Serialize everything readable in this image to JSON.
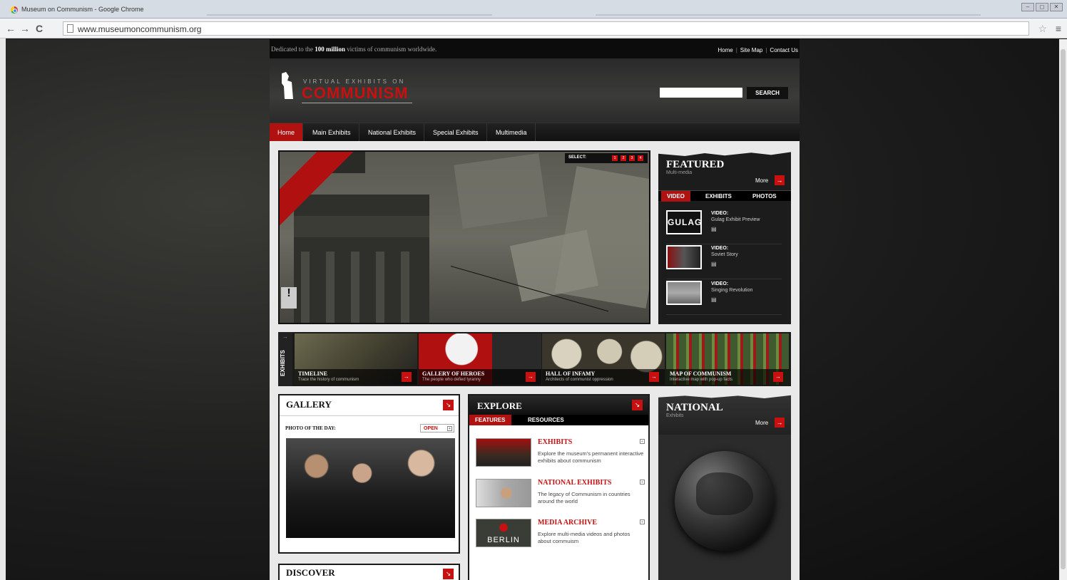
{
  "browser": {
    "window_title": "Museum on Communism - Google Chrome",
    "url": "www.museumoncommunism.org",
    "window_buttons": [
      "‒",
      "◻",
      "✕"
    ]
  },
  "site": {
    "dedication_pre": "Dedicated to the ",
    "dedication_bold": "100 million",
    "dedication_post": " victims of communism worldwide.",
    "top_links": [
      "Home",
      "Site Map",
      "Contact Us"
    ],
    "logo_sub": "VIRTUAL EXHIBITS ON",
    "logo_main": "COMMUNISM",
    "search_button": "SEARCH",
    "nav": [
      "Home",
      "Main Exhibits",
      "National Exhibits",
      "Special Exhibits",
      "Multimedia"
    ]
  },
  "hero": {
    "select_label": "SELECT:",
    "slides": [
      "1",
      "2",
      "3",
      "4"
    ],
    "sign": "!"
  },
  "featured": {
    "title": "FEATURED",
    "subtitle": "Multi-media",
    "more": "More",
    "tabs": [
      "VIDEO",
      "EXHIBITS",
      "PHOTOS"
    ],
    "videos": [
      {
        "label": "VIDEO:",
        "title": "Gulag Exhibit Preview",
        "thumb_text": "GULAG"
      },
      {
        "label": "VIDEO:",
        "title": "Soviet Story",
        "thumb_text": ""
      },
      {
        "label": "VIDEO:",
        "title": "Singing Revolution",
        "thumb_text": ""
      }
    ]
  },
  "exhibits_strip": {
    "label": "EXHIBITS",
    "arrow": "→",
    "tiles": [
      {
        "title": "TIMELINE",
        "subtitle": "Trace the history of communism"
      },
      {
        "title": "GALLERY OF HEROES",
        "subtitle": "The people who defied tyranny"
      },
      {
        "title": "HALL OF INFAMY",
        "subtitle": "Architects of communist oppression"
      },
      {
        "title": "MAP OF COMMUNISM",
        "subtitle": "Interactive map with pop-up facts"
      }
    ]
  },
  "gallery": {
    "title": "GALLERY",
    "photo_of_day": "PHOTO OF THE DAY:",
    "open": "OPEN"
  },
  "explore": {
    "title": "EXPLORE",
    "tabs": [
      "FEATURES",
      "RESOURCES"
    ],
    "items": [
      {
        "title": "EXHIBITS",
        "desc": "Explore the museum's permanent interactive exhibits about communism"
      },
      {
        "title": "NATIONAL EXHIBITS",
        "desc": "The legacy of Communism in countries around the world"
      },
      {
        "title": "MEDIA ARCHIVE",
        "desc": "Explore multi-media videos and photos about commuism",
        "thumb_text": "BERLIN"
      }
    ]
  },
  "national": {
    "title": "NATIONAL",
    "subtitle": "Exhibits",
    "more": "More"
  },
  "discover": {
    "title": "DISCOVER"
  },
  "colors": {
    "accent_red": "#c81010",
    "nav_active": "#b01212",
    "panel_dark": "#1c1c1c"
  }
}
